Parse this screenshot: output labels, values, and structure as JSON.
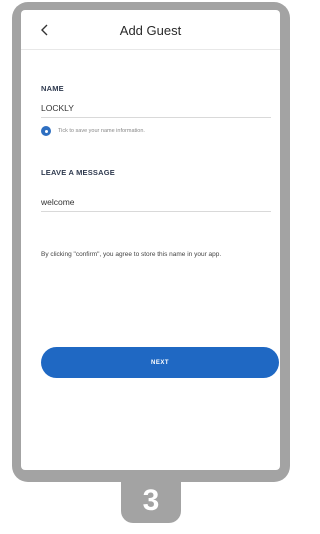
{
  "header": {
    "title": "Add Guest",
    "back_icon": "chevron-left-icon"
  },
  "name_section": {
    "label": "NAME",
    "value": "LOCKLY",
    "save_hint": "Tick to save your name information."
  },
  "message_section": {
    "label": "LEAVE A MESSAGE",
    "value": "welcome"
  },
  "disclaimer": "By clicking \"confirm\", you agree to store this name in your app.",
  "next_button": {
    "label": "NEXT"
  },
  "step_badge": "3",
  "colors": {
    "accent": "#1f68c3",
    "frame": "#a3a3a3"
  }
}
